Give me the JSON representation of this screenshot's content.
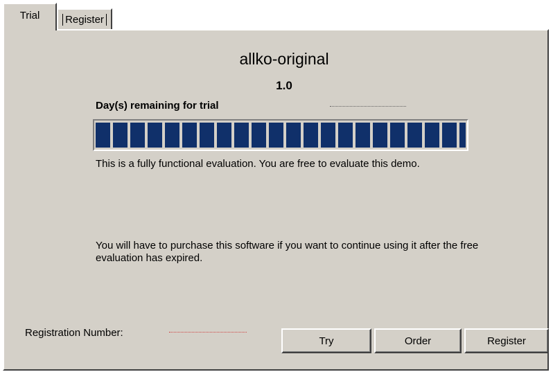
{
  "tabs": [
    {
      "label": "Trial",
      "active": true
    },
    {
      "label": "Register",
      "active": false
    }
  ],
  "app": {
    "name": "allko-original",
    "version": "1.0"
  },
  "trial": {
    "days_label": "Day(s) remaining for trial",
    "days_value": "",
    "progress_percent": 100,
    "eval_text": "This is a fully functional evaluation. You are free to evaluate this demo.",
    "purchase_text": "You will have to purchase this software if you want to continue using it after the free evaluation has expired."
  },
  "registration": {
    "label": "Registration Number:",
    "value": ""
  },
  "buttons": {
    "try": "Try",
    "order": "Order",
    "register": "Register"
  },
  "colors": {
    "panel": "#d4d0c8",
    "progress_fill": "#10306a"
  }
}
